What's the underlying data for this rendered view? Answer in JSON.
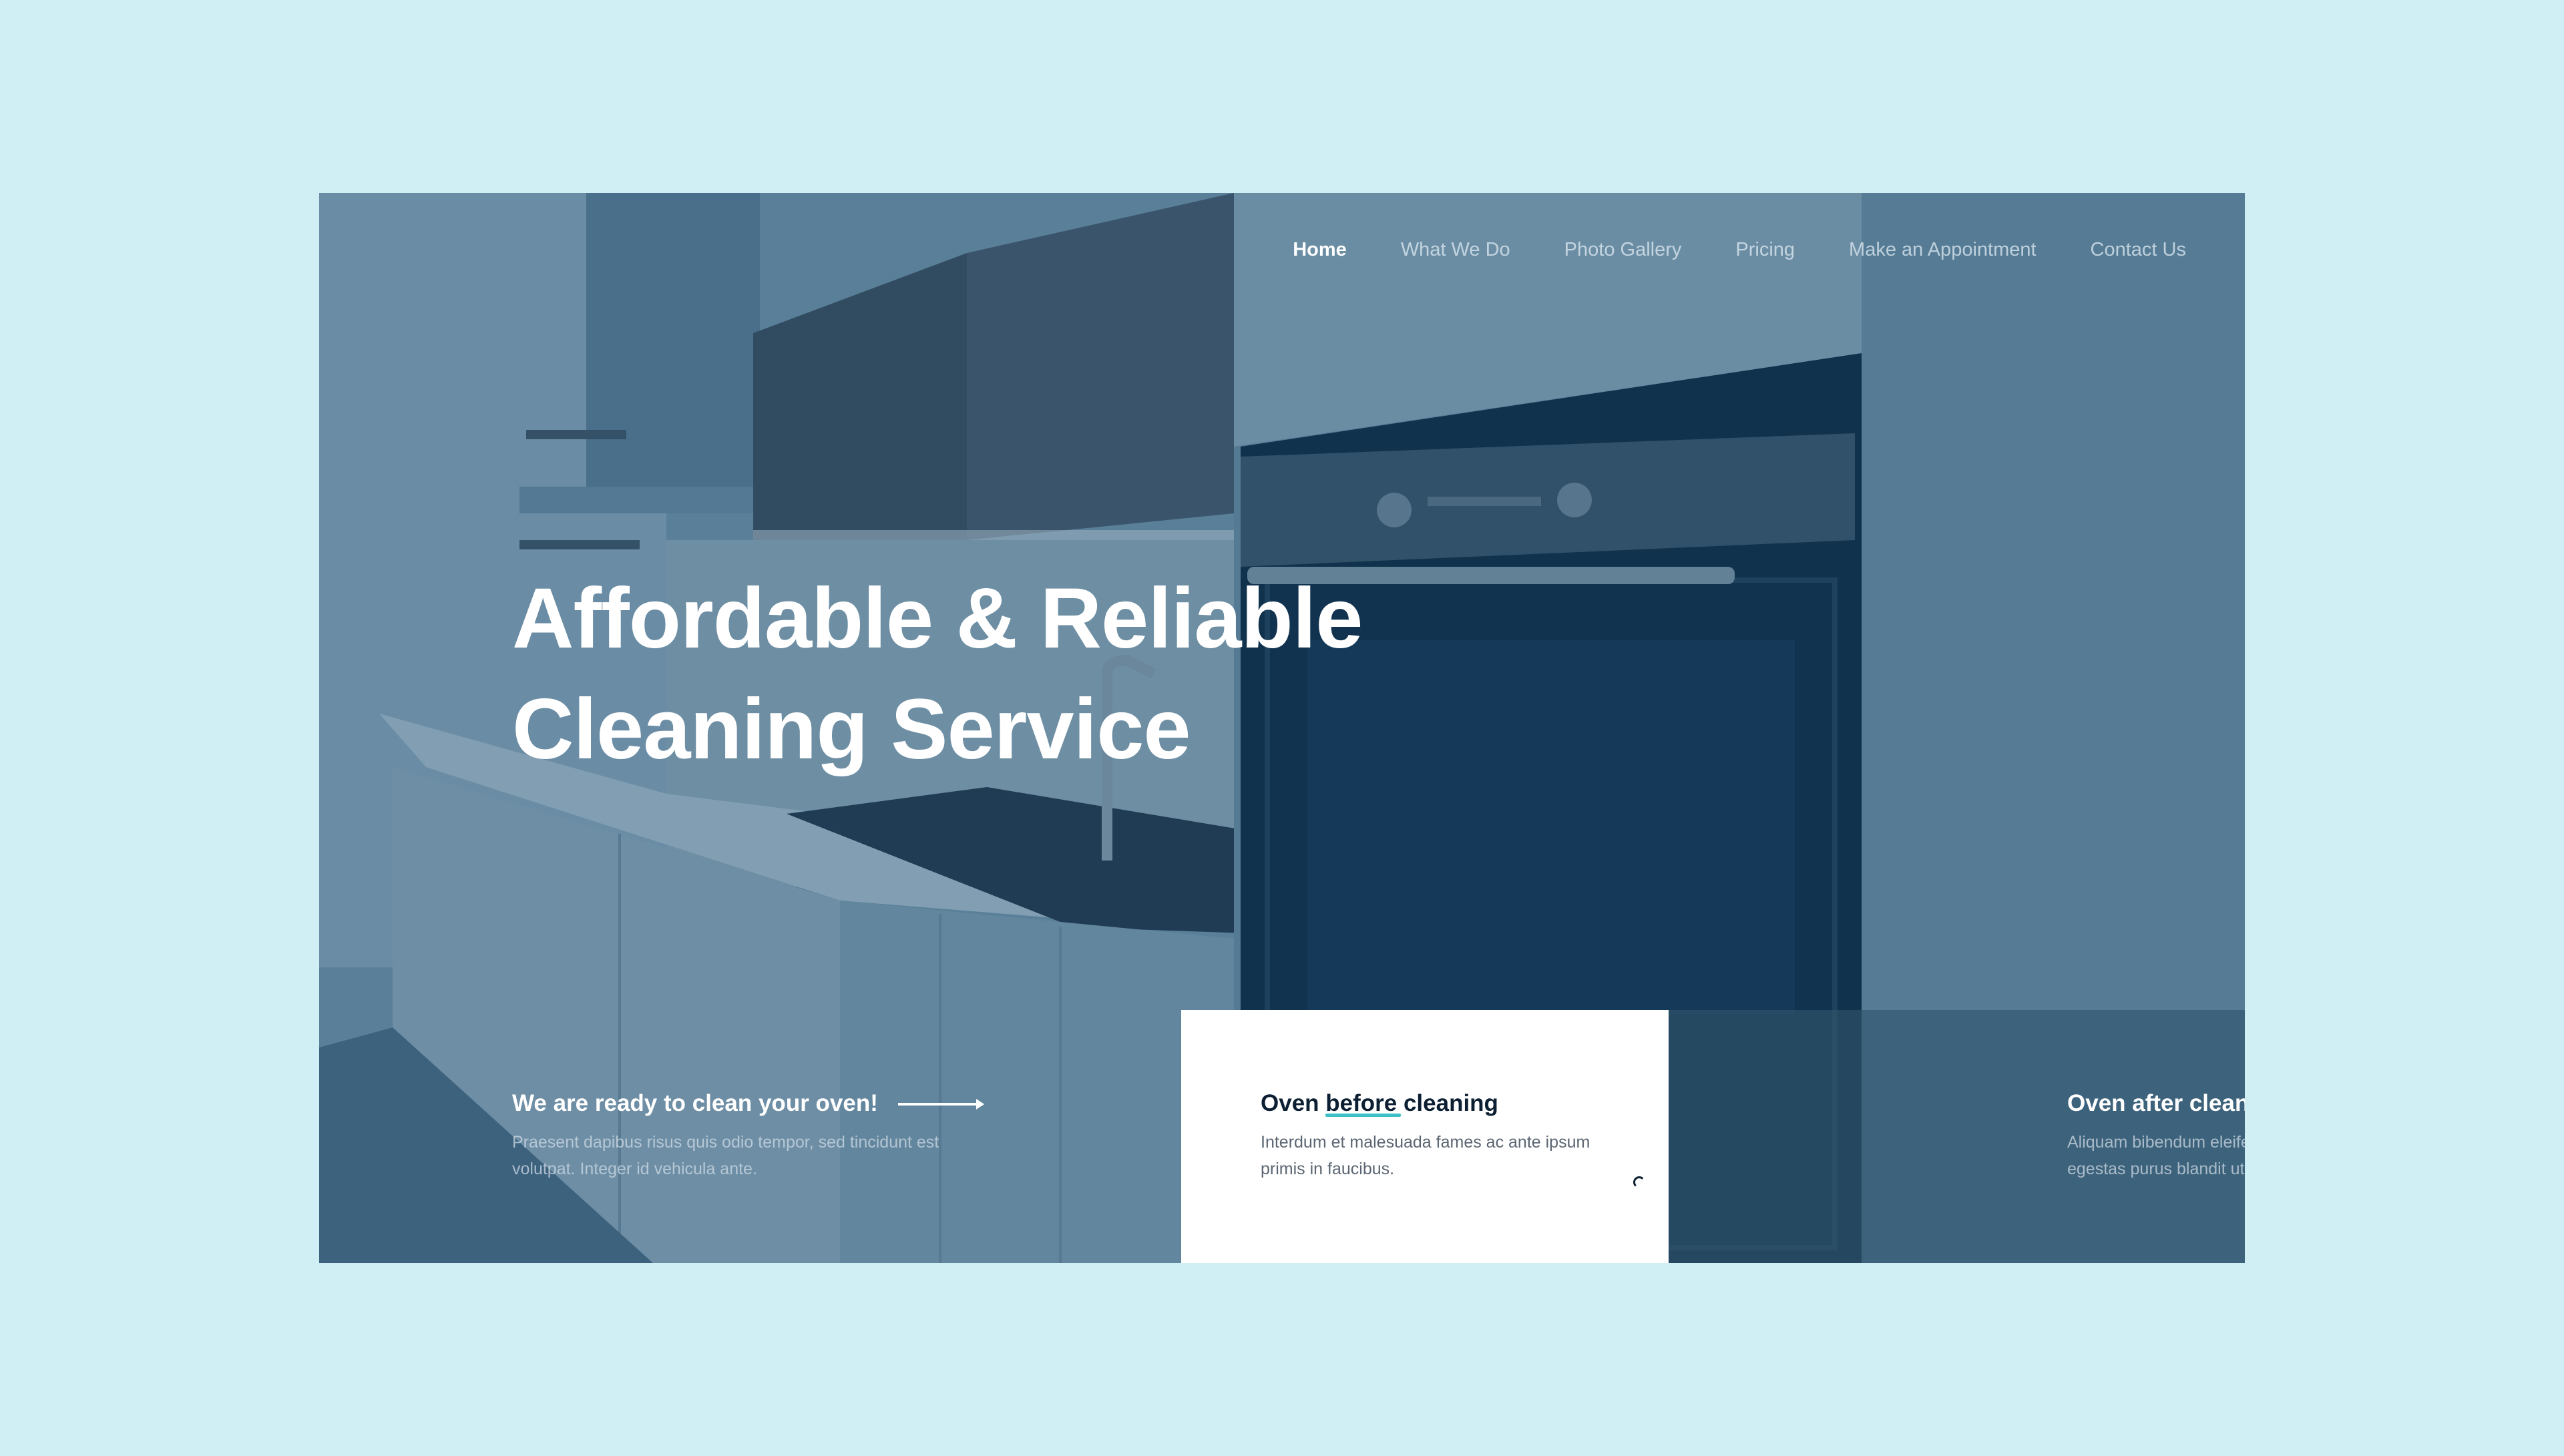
{
  "nav": {
    "items": [
      {
        "label": "Home",
        "active": true
      },
      {
        "label": "What We Do"
      },
      {
        "label": "Photo Gallery"
      },
      {
        "label": "Pricing"
      },
      {
        "label": "Make an Appointment"
      },
      {
        "label": "Contact Us"
      }
    ]
  },
  "hero": {
    "title_line1": "Affordable & Reliable",
    "title_line2": "Cleaning Service"
  },
  "cards": [
    {
      "title": "We are ready to clean your oven!",
      "text": "Praesent dapibus risus quis odio tempor, sed tincidunt est volutpat. Integer id vehicula ante."
    },
    {
      "title": "Oven before cleaning",
      "text": "Interdum et malesuada fames ac ante ipsum primis in faucibus."
    },
    {
      "title": "Oven after cleaning",
      "text": "Aliquam bibendum eleifend eros, fermentum egestas purus blandit ut."
    }
  ],
  "colors": {
    "page_background": "#cfeff5",
    "accent": "#3ec1c6",
    "overlay": "#184870",
    "card_white": "#ffffff",
    "dark_text": "#0d2033"
  },
  "icons": {
    "arrow": "arrow-right-icon",
    "spinner": "loading-spinner-icon"
  }
}
